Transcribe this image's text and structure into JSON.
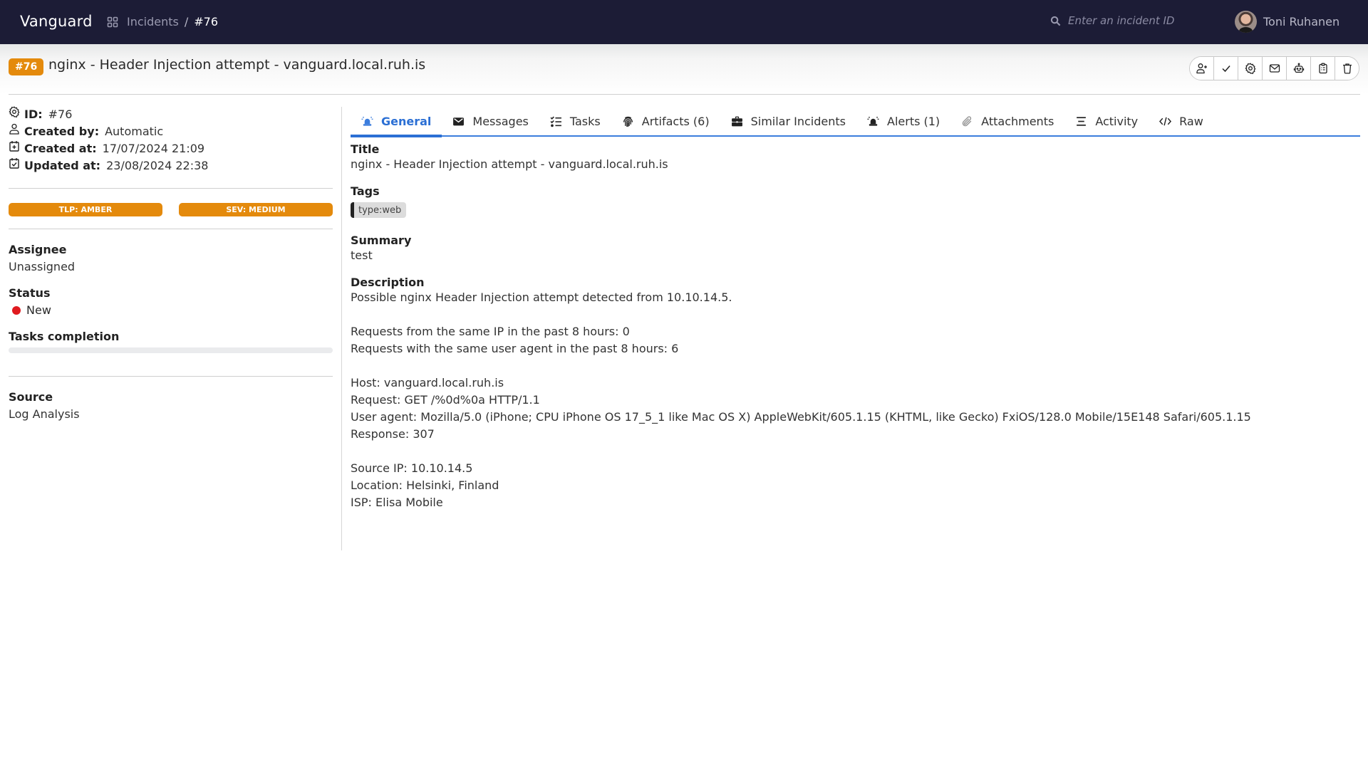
{
  "app": {
    "brand": "Vanguard",
    "breadcrumb": {
      "link": "Incidents",
      "separator": "/",
      "current": "#76"
    },
    "search": {
      "placeholder": "Enter an incident ID",
      "value": ""
    },
    "user": {
      "name": "Toni Ruhanen"
    }
  },
  "header": {
    "id_badge": "#76",
    "title": "nginx - Header Injection attempt - vanguard.local.ruh.is",
    "actions": [
      {
        "name": "assign-user",
        "icon": "user-plus-icon"
      },
      {
        "name": "close-incident",
        "icon": "check-icon"
      },
      {
        "name": "settings",
        "icon": "gear-icon"
      },
      {
        "name": "email",
        "icon": "envelope-icon"
      },
      {
        "name": "automation",
        "icon": "robot-icon"
      },
      {
        "name": "tasks-clipboard",
        "icon": "clipboard-icon"
      },
      {
        "name": "delete",
        "icon": "trash-icon"
      }
    ]
  },
  "sidebar": {
    "meta": [
      {
        "key": "ID:",
        "value": "#76",
        "icon": "gear-icon"
      },
      {
        "key": "Created by:",
        "value": "Automatic",
        "icon": "user-icon"
      },
      {
        "key": "Created at:",
        "value": "17/07/2024 21:09",
        "icon": "calendar-plus-icon"
      },
      {
        "key": "Updated at:",
        "value": "23/08/2024 22:38",
        "icon": "calendar-check-icon"
      }
    ],
    "tlp": "TLP: AMBER",
    "severity": "SEV: MEDIUM",
    "assignee": {
      "label": "Assignee",
      "value": "Unassigned"
    },
    "status": {
      "label": "Status",
      "value": "New",
      "color": "#e01a1f"
    },
    "tasks_completion": {
      "label": "Tasks completion",
      "percent": 0
    },
    "source": {
      "label": "Source",
      "value": "Log Analysis"
    }
  },
  "tabs": [
    {
      "label": "General",
      "icon": "siren-icon",
      "active": true
    },
    {
      "label": "Messages",
      "icon": "envelope-icon",
      "active": false
    },
    {
      "label": "Tasks",
      "icon": "checklist-icon",
      "active": false
    },
    {
      "label": "Artifacts (6)",
      "icon": "fingerprint-icon",
      "active": false
    },
    {
      "label": "Similar Incidents",
      "icon": "briefcase-icon",
      "active": false
    },
    {
      "label": "Alerts (1)",
      "icon": "siren-icon",
      "active": false
    },
    {
      "label": "Attachments",
      "icon": "paperclip-icon",
      "active": false
    },
    {
      "label": "Activity",
      "icon": "list-icon",
      "active": false
    },
    {
      "label": "Raw",
      "icon": "code-icon",
      "active": false
    }
  ],
  "general": {
    "title_label": "Title",
    "title_value": "nginx - Header Injection attempt - vanguard.local.ruh.is",
    "tags_label": "Tags",
    "tags": [
      "type:web"
    ],
    "summary_label": "Summary",
    "summary_value": "test",
    "description_label": "Description",
    "description_lines": [
      "Possible nginx Header Injection attempt detected from 10.10.14.5.",
      "",
      "Requests from the same IP in the past 8 hours: 0",
      "Requests with the same user agent in the past 8 hours: 6",
      "",
      "Host: vanguard.local.ruh.is",
      "Request: GET /%0d%0a HTTP/1.1",
      "User agent: Mozilla/5.0 (iPhone; CPU iPhone OS 17_5_1 like Mac OS X) AppleWebKit/605.1.15 (KHTML, like Gecko) FxiOS/128.0 Mobile/15E148 Safari/605.1.15",
      "Response: 307",
      "",
      "Source IP: 10.10.14.5",
      "Location: Helsinki, Finland",
      "ISP: Elisa Mobile"
    ]
  },
  "colors": {
    "navbar": "#1c1c36",
    "accent": "#2b6fd4",
    "amber": "#e48a0c",
    "status_new": "#e01a1f"
  }
}
